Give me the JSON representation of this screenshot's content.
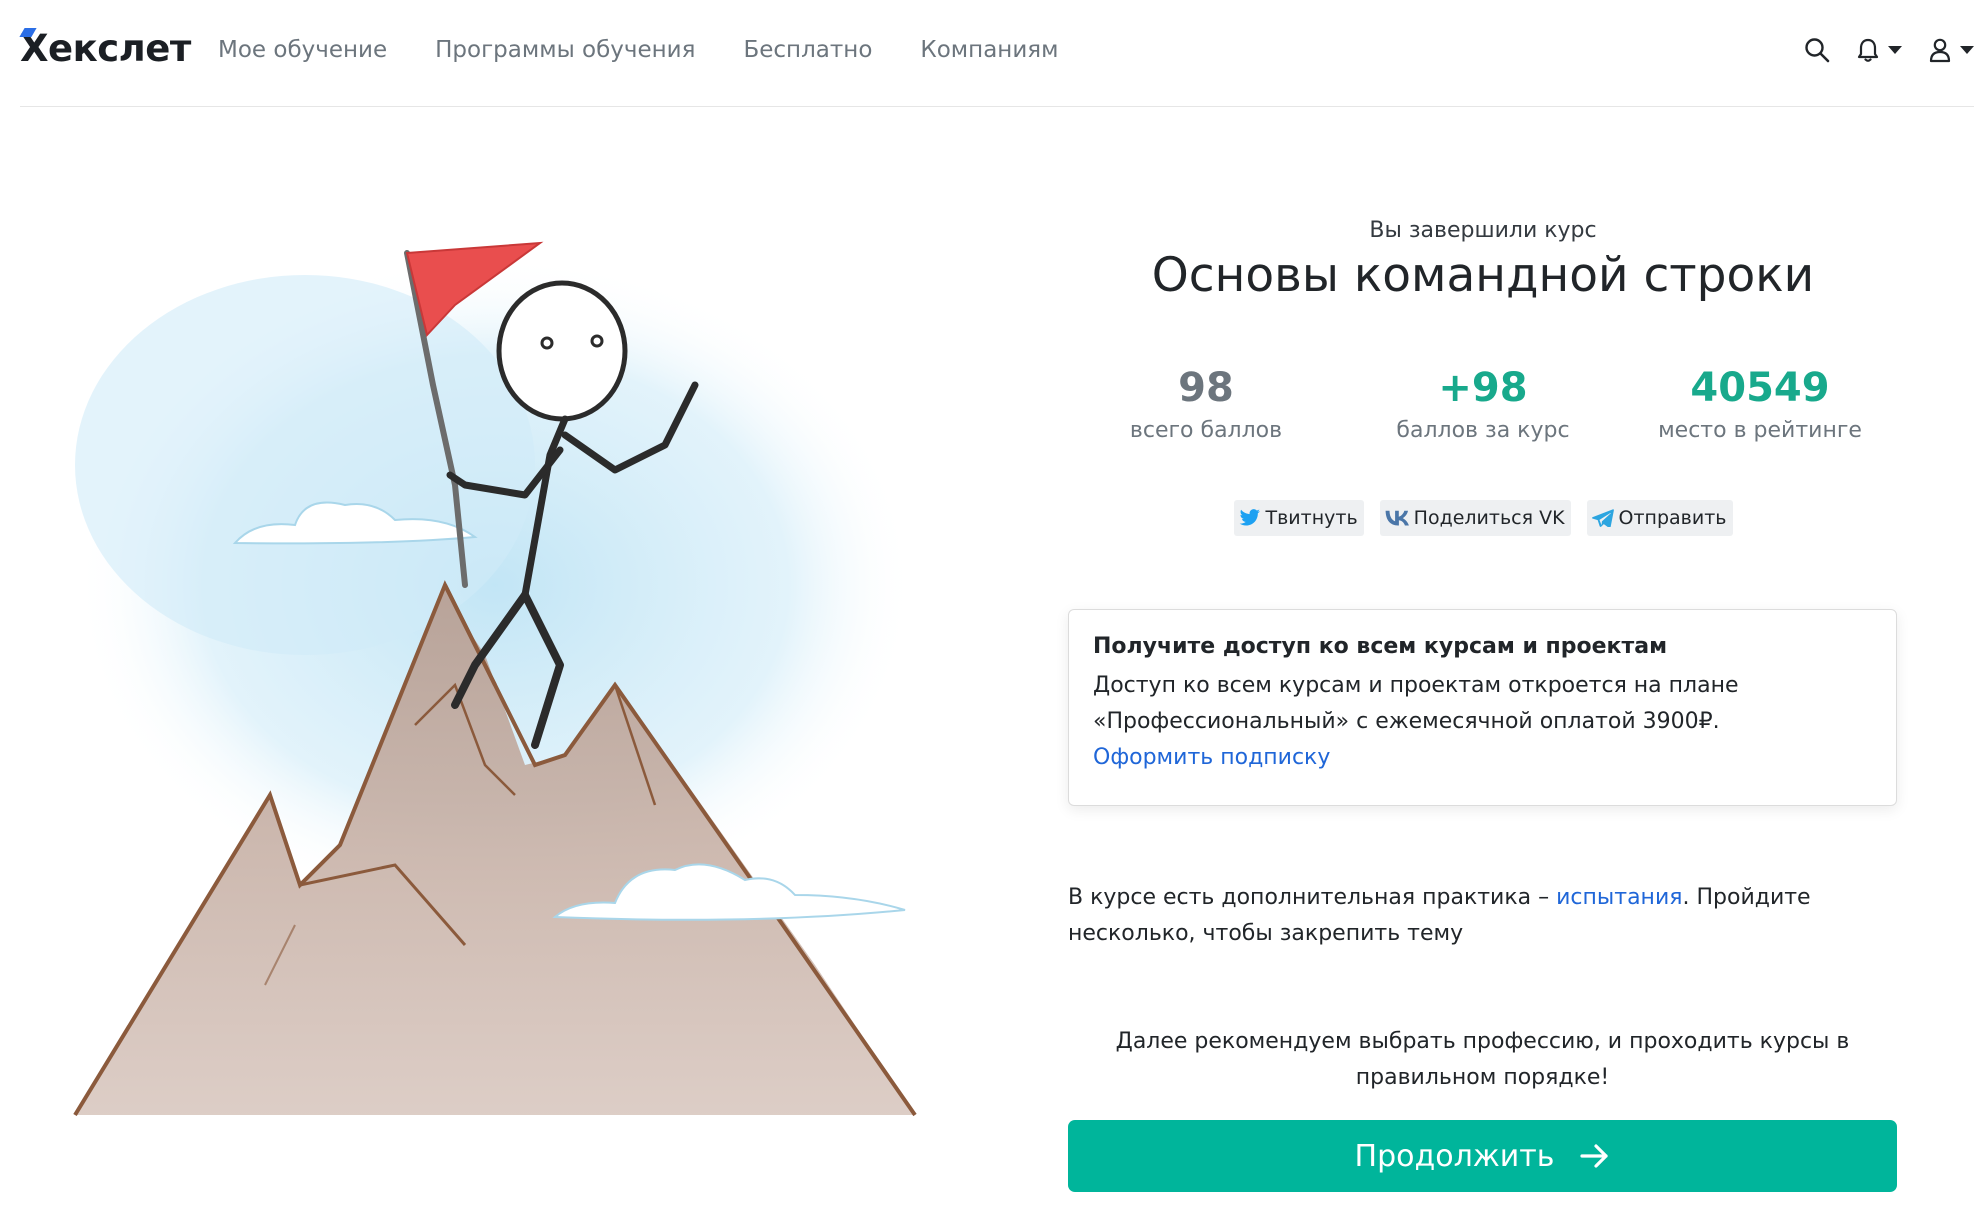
{
  "header": {
    "logo": "Хекслет",
    "nav": [
      {
        "label": "Мое обучение"
      },
      {
        "label": "Программы обучения"
      },
      {
        "label": "Бесплатно"
      },
      {
        "label": "Компаниям"
      }
    ],
    "icons": [
      "search-icon",
      "bell-icon",
      "user-icon"
    ]
  },
  "completion": {
    "subtitle": "Вы завершили курс",
    "course_title": "Основы командной строки"
  },
  "stats": [
    {
      "value": "98",
      "label": "всего баллов",
      "color": "#6c757d"
    },
    {
      "value": "+98",
      "label": "баллов за курс",
      "color": "#18a98c"
    },
    {
      "value": "40549",
      "label": "место в рейтинге",
      "color": "#18a98c"
    }
  ],
  "share": {
    "twitter": "Твитнуть",
    "vk": "Поделиться VK",
    "telegram": "Отправить"
  },
  "access_card": {
    "title": "Получите доступ ко всем курсам и проектам",
    "text_line1": "Доступ ко всем курсам и проектам откроется на плане",
    "text_line2": "«Профессиональный» с ежемесячной оплатой 3900₽.",
    "link": "Оформить подписку"
  },
  "practice": {
    "before": "В курсе есть дополнительная практика – ",
    "link": "испытания",
    "after": ". Пройдите несколько, чтобы закрепить тему"
  },
  "recommend": {
    "line1": "Далее рекомендуем выбрать профессию, и проходить курсы в",
    "line2": "правильном порядке!"
  },
  "continue_button": "Продолжить",
  "colors": {
    "accent": "#00b59b",
    "link": "#1f66d8",
    "flag": "#e94e4e",
    "mountain": "#8b5a3c",
    "sky": "#cfe9f6"
  }
}
